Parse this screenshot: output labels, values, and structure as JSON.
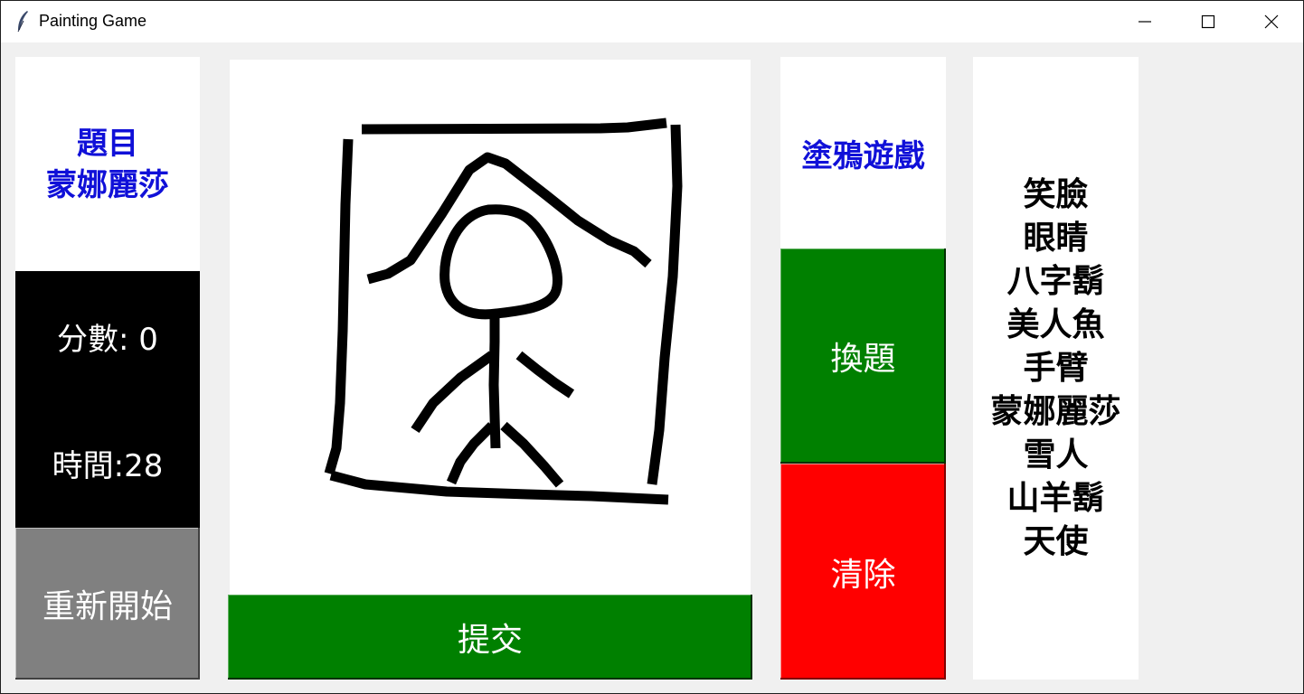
{
  "window": {
    "title": "Painting Game",
    "controls": {
      "minimize": "minimize-icon",
      "maximize": "maximize-icon",
      "close": "close-icon"
    }
  },
  "left": {
    "topic_heading": "題目",
    "topic_word": "蒙娜麗莎",
    "score_text": "分數: 0",
    "time_text": "時間:28",
    "restart_label": "重新開始"
  },
  "canvas": {
    "submit_label": "提交"
  },
  "right": {
    "game_title": "塗鴉遊戲",
    "change_label": "換題",
    "clear_label": "清除"
  },
  "word_list": [
    "笑臉",
    "眼睛",
    "八字鬍",
    "美人魚",
    "手臂",
    "蒙娜麗莎",
    "雪人",
    "山羊鬍",
    "天使"
  ],
  "colors": {
    "title_blue": "#1010d8",
    "green": "#008000",
    "red": "#ff0000",
    "gray": "#808080",
    "black": "#000000"
  }
}
